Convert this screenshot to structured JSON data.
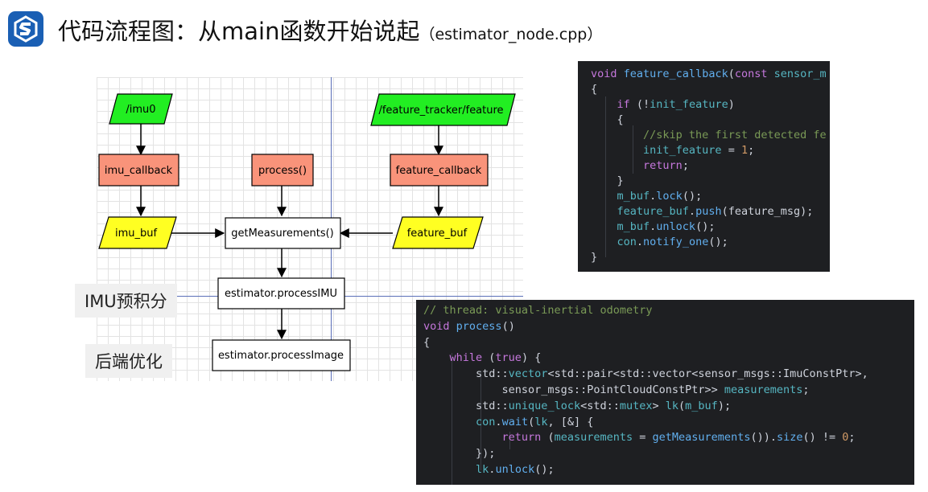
{
  "header": {
    "title": "代码流程图：从main函数开始说起",
    "subtitle": "（estimator_node.cpp）"
  },
  "colors": {
    "topic_green": "#22ee22",
    "callback_salmon": "#f9937a",
    "buffer_yellow": "#ffff22",
    "process_white": "#ffffff",
    "logo_blue": "#1a5fb4"
  },
  "flowchart": {
    "imu_topic": "/imu0",
    "feature_topic": "/feature_tracker/feature",
    "imu_callback": "imu_callback",
    "process": "process()",
    "feature_callback": "feature_callback",
    "imu_buf": "imu_buf",
    "get_measurements": "getMeasurements()",
    "feature_buf": "feature_buf",
    "process_imu": "estimator.processIMU",
    "process_image": "estimator.processImage"
  },
  "labels": {
    "imu_preintegration": "IMU预积分",
    "backend_optimization": "后端优化"
  },
  "code_top": {
    "lines": [
      "void feature_callback(const sensor_m",
      "{",
      "    if (!init_feature)",
      "    {",
      "        //skip the first detected fe",
      "        init_feature = 1;",
      "        return;",
      "    }",
      "    m_buf.lock();",
      "    feature_buf.push(feature_msg);",
      "    m_buf.unlock();",
      "    con.notify_one();",
      "}"
    ]
  },
  "code_bottom": {
    "lines": [
      "// thread: visual-inertial odometry",
      "void process()",
      "{",
      "    while (true) {",
      "        std::vector<std::pair<std::vector<sensor_msgs::ImuConstPtr>,",
      "            sensor_msgs::PointCloudConstPtr>> measurements;",
      "        std::unique_lock<std::mutex> lk(m_buf);",
      "        con.wait(lk, [&] {",
      "            return (measurements = getMeasurements()).size() != 0;",
      "        });",
      "        lk.unlock();"
    ]
  }
}
